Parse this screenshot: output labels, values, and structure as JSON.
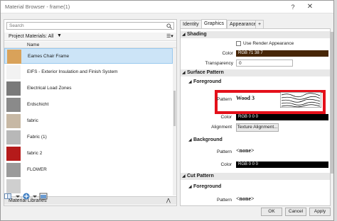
{
  "window": {
    "title": "Material Browser - frame(1)",
    "help_glyph": "?",
    "close_glyph": "✕"
  },
  "left_panel": {
    "search_placeholder": "Search",
    "project_materials_label": "Project Materials: All",
    "filter_glyph": "▼",
    "view_glyph": "☰▾",
    "column_name": "Name",
    "materials": [
      {
        "name": "Eames Chair Frame",
        "thumb_color": "#d9a25a",
        "selected": true
      },
      {
        "name": "EIFS - Exterior Insulation and Finish System",
        "thumb_color": "#f2f2f2",
        "selected": false
      },
      {
        "name": "Electrical Load Zones",
        "thumb_color": "#7a7a7a",
        "selected": false
      },
      {
        "name": "Erdschicht",
        "thumb_color": "#8a8a8a",
        "selected": false
      },
      {
        "name": "fabric",
        "thumb_color": "#c7b8a4",
        "selected": false
      },
      {
        "name": "Fabric (1)",
        "thumb_color": "#b8b8b8",
        "selected": false
      },
      {
        "name": "fabric 2",
        "thumb_color": "#b51a1a",
        "selected": false
      },
      {
        "name": "FLOWER",
        "thumb_color": "#9a9a9a",
        "selected": false
      },
      {
        "name": "",
        "thumb_color": "#cfcfcf",
        "selected": false
      }
    ],
    "libraries_label": "Material Libraries",
    "libraries_chevron": "⋀"
  },
  "tabs": [
    {
      "label": "Identity",
      "active": false
    },
    {
      "label": "Graphics",
      "active": true
    },
    {
      "label": "Appearance",
      "active": false
    },
    {
      "label": "+",
      "active": false
    }
  ],
  "graphics": {
    "shading": {
      "title": "Shading",
      "use_render_label": "Use Render Appearance",
      "color_label": "Color",
      "color_value": "RGB 71 38 7",
      "color_hex": "#472607",
      "transparency_label": "Transparency",
      "transparency_value": "0"
    },
    "surface_pattern": {
      "title": "Surface Pattern",
      "foreground": {
        "title": "Foreground",
        "pattern_label": "Pattern",
        "pattern_value": "Wood 3",
        "color_label": "Color",
        "color_value": "RGB 0 0 0",
        "alignment_label": "Alignment",
        "alignment_button": "Texture Alignment..."
      },
      "background": {
        "title": "Background",
        "pattern_label": "Pattern",
        "pattern_value": "<none>",
        "color_label": "Color",
        "color_value": "RGB 0 0 0"
      }
    },
    "cut_pattern": {
      "title": "Cut Pattern",
      "foreground": {
        "title": "Foreground",
        "pattern_label": "Pattern",
        "pattern_value": "<none>"
      }
    },
    "highlight_color": "#e4101a"
  },
  "footer": {
    "ok": "OK",
    "cancel": "Cancel",
    "apply": "Apply"
  }
}
